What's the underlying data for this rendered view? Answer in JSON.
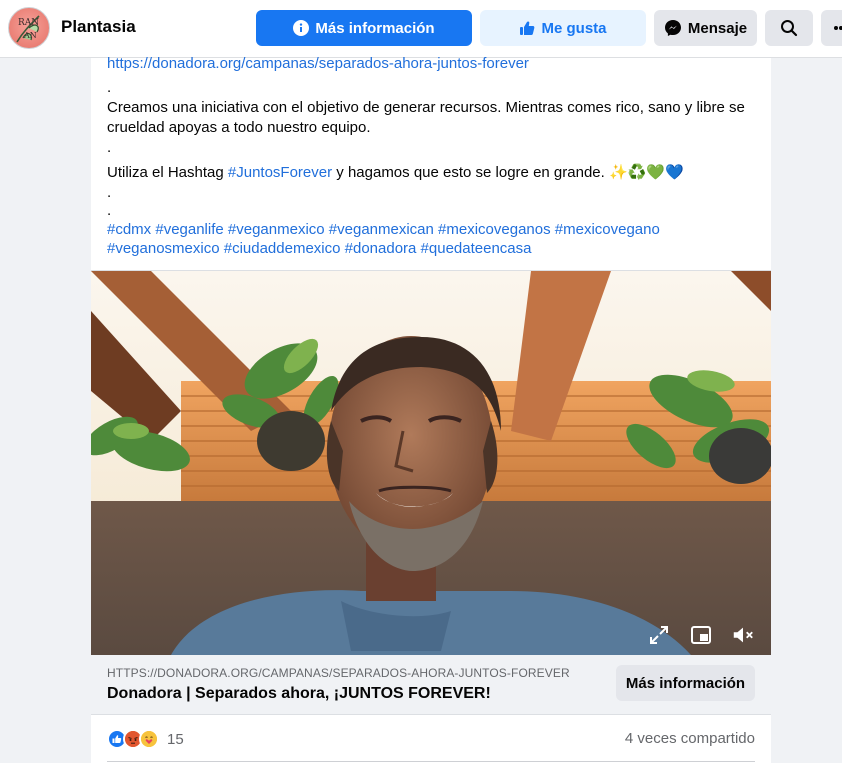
{
  "header": {
    "page_name": "Plantasia",
    "buttons": {
      "more_info": "Más información",
      "like": "Me gusta",
      "message": "Mensaje"
    }
  },
  "post": {
    "lines": {
      "url": "https://donadora.org/campanas/separados-ahora-juntos-forever",
      "dot1": ".",
      "body_line1": "Creamos una iniciativa con el objetivo de generar recursos. Mientras comes rico, sano y libre se",
      "body_line2": "crueldad apoyas a todo nuestro equipo.",
      "dot2": ".",
      "hashtag_prefix": "Utiliza el Hashtag ",
      "hashtag_main": "#JuntosForever",
      "hashtag_suffix": " y hagamos que esto se logre en grande. ✨♻️💚💙",
      "dot3": ".",
      "dot4": ".",
      "tags_line1": "#cdmx #veganlife #veganmexico #veganmexican #mexicoveganos #mexicovegano",
      "tags_line2": "#veganosmexico #ciudaddemexico #donadora #quedateencasa"
    }
  },
  "video": {
    "controls": [
      "fullscreen-icon",
      "picture-in-picture-icon",
      "muted-speaker-icon"
    ]
  },
  "link_preview": {
    "domain": "HTTPS://DONADORA.ORG/CAMPANAS/SEPARADOS-AHORA-JUNTOS-FOREVER",
    "title": "Donadora | Separados ahora, ¡JUNTOS FOREVER!",
    "button": "Más información"
  },
  "engagement": {
    "reactions": [
      "like",
      "angry",
      "care"
    ],
    "reaction_count": "15",
    "shares": "4 veces compartido"
  },
  "colors": {
    "primary": "#1877f2",
    "link": "#216fdb",
    "secondary_text": "#65676b"
  }
}
